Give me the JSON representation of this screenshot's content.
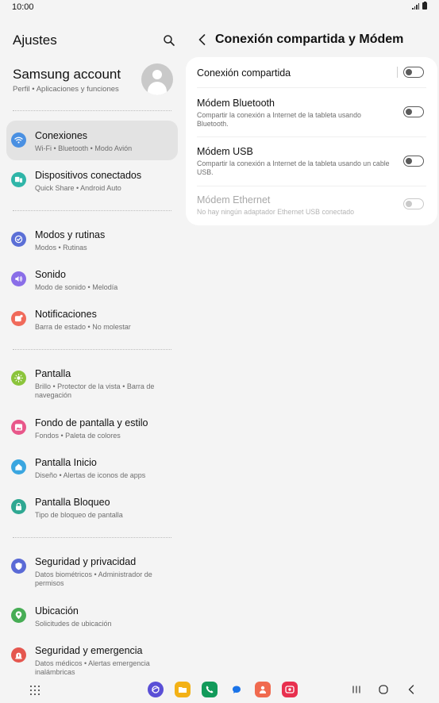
{
  "status_bar": {
    "time": "10:00"
  },
  "left_panel": {
    "title": "Ajustes",
    "account": {
      "name": "Samsung account",
      "subtitle": "Perfil  •  Aplicaciones y funciones"
    },
    "groups": [
      [
        {
          "label": "Conexiones",
          "sub": "Wi-Fi  •  Bluetooth  •  Modo Avión",
          "icon": "wifi-icon",
          "color": "#4a90e2",
          "active": true
        },
        {
          "label": "Dispositivos conectados",
          "sub": "Quick Share  •  Android Auto",
          "icon": "devices-icon",
          "color": "#2fb5a8"
        }
      ],
      [
        {
          "label": "Modos y rutinas",
          "sub": "Modos  •  Rutinas",
          "icon": "modes-icon",
          "color": "#5b6fd6"
        },
        {
          "label": "Sonido",
          "sub": "Modo de sonido  •  Melodía",
          "icon": "sound-icon",
          "color": "#8a6ee8"
        },
        {
          "label": "Notificaciones",
          "sub": "Barra de estado  •  No molestar",
          "icon": "notifications-icon",
          "color": "#f06a5a"
        }
      ],
      [
        {
          "label": "Pantalla",
          "sub": "Brillo  •  Protector de la vista  •  Barra de navegación",
          "icon": "display-icon",
          "color": "#8bc43b"
        },
        {
          "label": "Fondo de pantalla y estilo",
          "sub": "Fondos  •  Paleta de colores",
          "icon": "wallpaper-icon",
          "color": "#e8578a"
        },
        {
          "label": "Pantalla Inicio",
          "sub": "Diseño  •  Alertas de iconos de apps",
          "icon": "home-screen-icon",
          "color": "#3aa6e0"
        },
        {
          "label": "Pantalla Bloqueo",
          "sub": "Tipo de bloqueo de pantalla",
          "icon": "lock-icon",
          "color": "#2fa892"
        }
      ],
      [
        {
          "label": "Seguridad y privacidad",
          "sub": "Datos biométricos  •  Administrador de permisos",
          "icon": "shield-icon",
          "color": "#5a6ad6"
        },
        {
          "label": "Ubicación",
          "sub": "Solicitudes de ubicación",
          "icon": "location-icon",
          "color": "#47ad55"
        },
        {
          "label": "Seguridad y emergencia",
          "sub": "Datos médicos  •  Alertas emergencia inalámbricas",
          "icon": "emergency-icon",
          "color": "#e5574f"
        }
      ]
    ]
  },
  "right_panel": {
    "title": "Conexión compartida y Módem",
    "rows": [
      {
        "label": "Conexión compartida",
        "sub": "",
        "enabled": true
      },
      {
        "label": "Módem Bluetooth",
        "sub": "Compartir la conexión a Internet de la tableta usando Bluetooth.",
        "enabled": true
      },
      {
        "label": "Módem USB",
        "sub": "Compartir la conexión a Internet de la tableta usando un cable USB.",
        "enabled": true
      },
      {
        "label": "Módem Ethernet",
        "sub": "No hay ningún adaptador Ethernet USB conectado",
        "enabled": false
      }
    ]
  },
  "colors": {
    "background": "#f4f4f4",
    "card": "#ffffff",
    "active_item": "#e3e3e3"
  }
}
